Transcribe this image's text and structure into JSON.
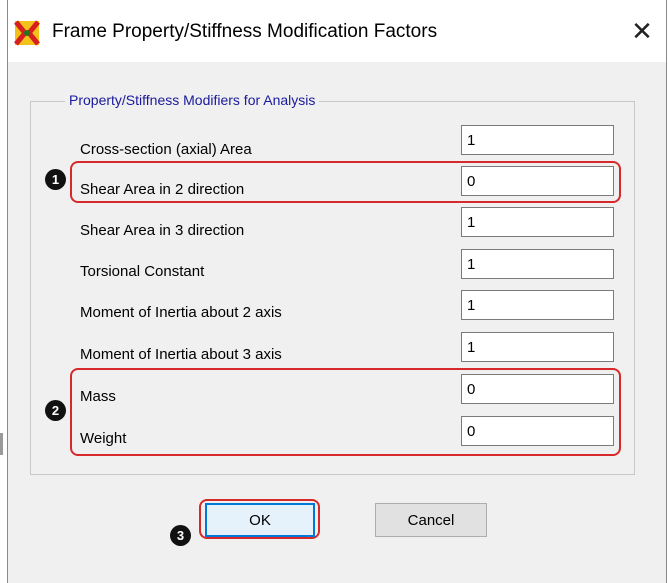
{
  "window": {
    "title": "Frame Property/Stiffness Modification Factors",
    "close_glyph": "✕"
  },
  "group": {
    "label": "Property/Stiffness Modifiers for Analysis"
  },
  "fields": [
    {
      "label": "Cross-section (axial) Area",
      "value": "1"
    },
    {
      "label": "Shear Area in 2 direction",
      "value": "0"
    },
    {
      "label": "Shear Area in 3 direction",
      "value": "1"
    },
    {
      "label": "Torsional Constant",
      "value": "1"
    },
    {
      "label": "Moment of Inertia about 2 axis",
      "value": "1"
    },
    {
      "label": "Moment of Inertia about 3 axis",
      "value": "1"
    },
    {
      "label": "Mass",
      "value": "0"
    },
    {
      "label": "Weight",
      "value": "0"
    }
  ],
  "annotations": {
    "badge1": "1",
    "badge2": "2",
    "badge3": "3",
    "color": "#d62a2a"
  },
  "buttons": {
    "ok_label": "OK",
    "cancel_label": "Cancel"
  },
  "icons": {
    "app": "sap2000-app-icon",
    "close": "close-icon"
  },
  "colors": {
    "group_label": "#1a1a9c",
    "default_button_border": "#0078d7",
    "dialog_bg": "#f0f0f0"
  }
}
